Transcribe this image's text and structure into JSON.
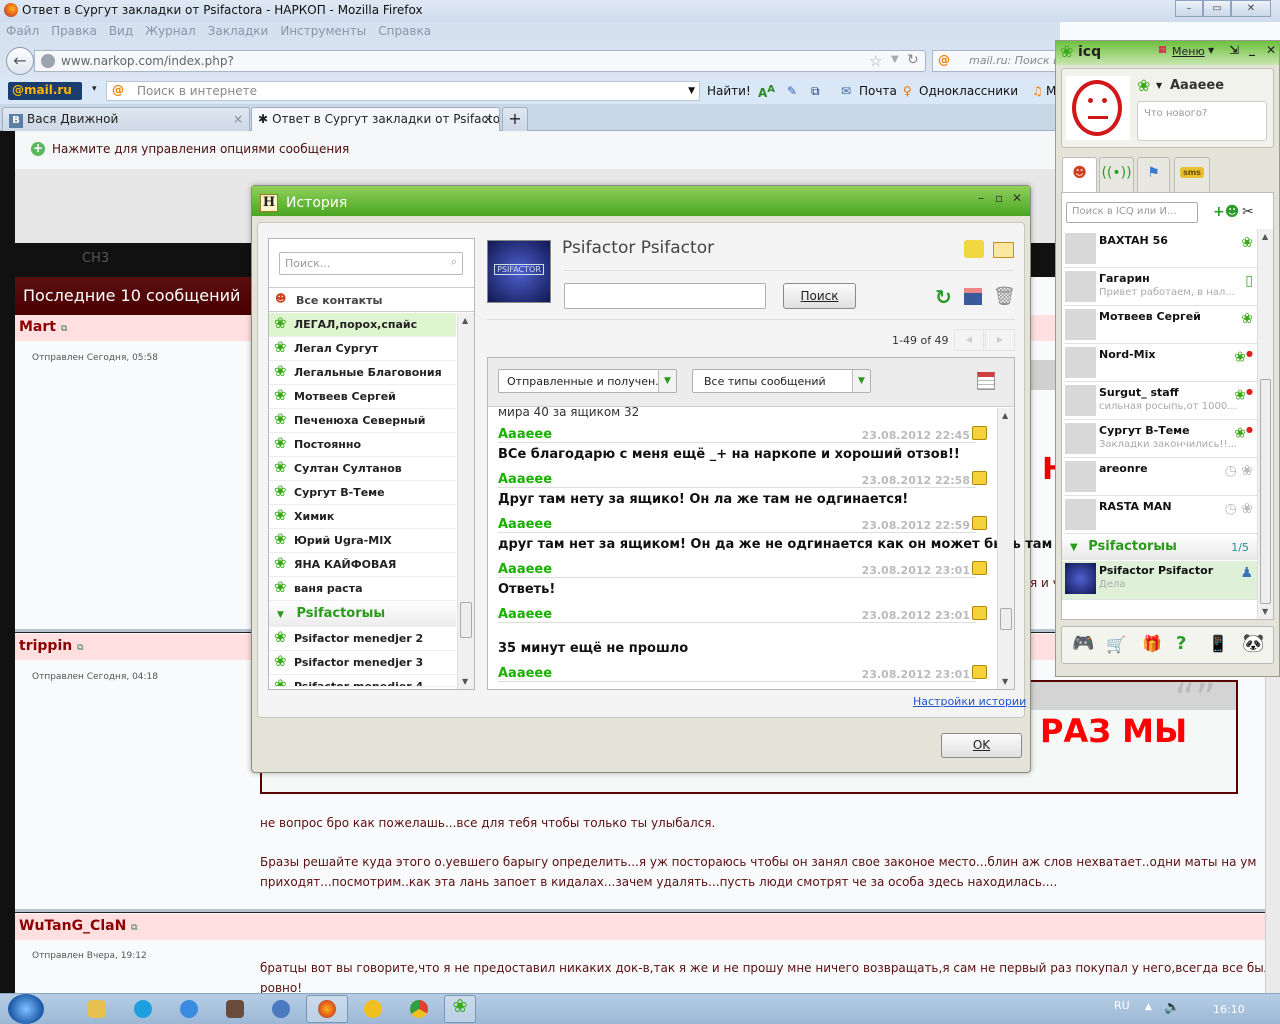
{
  "browser": {
    "title": "Ответ в Сургут закладки от Psifactora - НАРКОП - Mozilla Firefox",
    "menu": [
      "Файл",
      "Правка",
      "Вид",
      "Журнал",
      "Закладки",
      "Инструменты",
      "Справка"
    ],
    "url": "www.narkop.com/index.php?",
    "search_placeholder": "mail.ru: Поиск в",
    "mailru": {
      "logo": "@mail.ru",
      "search_placeholder": "Поиск в интернете",
      "find": "Найти!",
      "mail": "Почта",
      "ok": "Одноклассники",
      "more": "М"
    },
    "tabs": [
      {
        "label": "Вася Движной",
        "icon": "B"
      },
      {
        "label": "Ответ в Сургут закладки от Psifactor..."
      }
    ],
    "new_tab": "+"
  },
  "page": {
    "notice": "Нажмите для управления опциями сообщения",
    "logo_fragment": "CH3",
    "sidebar_header": "Последние 10 сообщений",
    "posts": [
      {
        "user": "Mart",
        "sent": "Отправлен Сегодня, 05:58"
      },
      {
        "user": "trippin",
        "sent": "Отправлен Сегодня, 04:18"
      },
      {
        "user": "WuTanG_ClaN",
        "sent": "Отправлен Вчера, 19:12"
      }
    ],
    "partial_text_1": "Н",
    "partial_text_2": "я и ч",
    "banner_text": "РАЗ МЫ",
    "paragraphs": [
      "не вопрос бро как пожелашь...все для тебя чтобы только ты улыбался.",
      "Бразы решайте куда этого о.уевшего барыгу определить...я уж постораюсь чтобы он занял свое законое место...блин аж слов нехватает..одни маты на ум",
      "приходят...посмотрим..как эта лань запоет в кидалах...зачем удалять...пусть люди смотрят че за особа здесь находилась....",
      "братцы вот вы говорите,что я не предоставил никаких док-в,так я же и не прошу мне ничего возвращать,я сам не первый раз покупал у него,всегда все было",
      "ровно!"
    ]
  },
  "history": {
    "title": "История",
    "title_icon": "H",
    "search_placeholder": "Поиск...",
    "all_contacts": "Все контакты",
    "contacts": [
      "ЛЕГАЛ,порох,спайс",
      "Легал Сургут",
      "Легальные Благовония",
      "Мотвеев Сергей",
      "Печенюха Северный",
      "Постоянно",
      "Султан Султанов",
      "Сургут В-Теме",
      "Химик",
      "Юрий Ugra-MIX",
      "ЯНА КАЙФОВАЯ",
      "ваня раста"
    ],
    "group": "Psifactorыы",
    "group_contacts": [
      "Psifactor menedjer 2",
      "Psifactor menedjer 3",
      "Psifactor menedjer 4"
    ],
    "contact_name": "Psifactor Psifactor",
    "avatar_text": "PSIFACTOR",
    "search_value": "",
    "search_button": "Поиск",
    "pagination": "1-49 of 49",
    "filter_direction": "Отправленные и получен...",
    "filter_type": "Все типы сообщений",
    "partial_top": "мира 40 за ящиком 32",
    "messages": [
      {
        "author": "Aaaeee",
        "date": "23.08.2012 22:45",
        "text": "ВСе благодарю с меня ещё _+ на наркопе и хороший отзов!!"
      },
      {
        "author": "Aaaeee",
        "date": "23.08.2012 22:58",
        "text": "Друг там нету за ящико! Он ла же там не одгинается!"
      },
      {
        "author": "Aaaeee",
        "date": "23.08.2012 22:59",
        "text": "друг там нет за ящиком! Он да же не одгинается как он может быть там"
      },
      {
        "author": "Aaaeee",
        "date": "23.08.2012 23:01",
        "text": "Ответь!"
      },
      {
        "author": "Aaaeee",
        "date": "23.08.2012 23:01",
        "text": "35 минут ещё не прошло"
      },
      {
        "author": "Aaaeee",
        "date": "23.08.2012 23:01",
        "text": ""
      }
    ],
    "settings_link": "Настройки истории",
    "ok_button": "OK"
  },
  "icq": {
    "logo": "icq",
    "menu": "Меню",
    "username": "Aaaeee",
    "status_placeholder": "Что нового?",
    "search_placeholder": "Поиск в ICQ или И...",
    "contacts": [
      {
        "name": "BAXTAH 56",
        "status": "",
        "icon": "online"
      },
      {
        "name": "Гагарин",
        "status": "Привет работаем, в нал...",
        "icon": "mobile"
      },
      {
        "name": "Мотвеев Сергей",
        "status": "",
        "icon": "online"
      },
      {
        "name": "Nord-Mix",
        "status": "",
        "icon": "dnd"
      },
      {
        "name": "Surgut_ staff",
        "status": "сильная росыпь,от 1000...",
        "icon": "dnd"
      },
      {
        "name": "Сургут В-Теме",
        "status": "Закладки закончились!!...",
        "icon": "dnd"
      },
      {
        "name": "areonre",
        "status": "",
        "icon": "offline"
      },
      {
        "name": "RASTA MAN",
        "status": "",
        "icon": "offline"
      }
    ],
    "group": {
      "name": "Psifactorыы",
      "count": "1/5"
    },
    "selected_contact": {
      "name": "Psifactor Psifactor",
      "status": "Дела"
    }
  },
  "taskbar": {
    "lang": "RU",
    "clock": "16:10"
  },
  "colors": {
    "icq_green": "#3aaa1a",
    "history_author": "#19b000",
    "post_user": "#8b0000",
    "banner_red": "#ff0000"
  }
}
